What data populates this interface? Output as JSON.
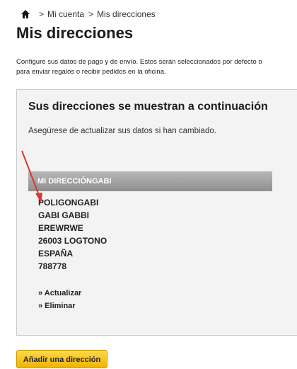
{
  "breadcrumb": {
    "separator": ">",
    "items": [
      "Mi cuenta",
      "Mis direcciones"
    ]
  },
  "page": {
    "title": "Mis direcciones",
    "intro_line1": "Configure sus datos de pago y de envío. Estos serán seleccionados por defecto o",
    "intro_line2": "para enviar regalos o recibir pedidos en la oficina."
  },
  "panel": {
    "heading": "Sus direcciones se muestran a continuación",
    "note": "Asegúrese de actualizar sus datos si han cambiado."
  },
  "address": {
    "title": "MI DIRECCIÓNGABI",
    "lines": [
      "POLIGONGABI",
      "GABI GABBI",
      "EREWRWE",
      "26003 LOGTONO",
      "ESPAÑA",
      "788778"
    ],
    "update_label": "» Actualizar",
    "delete_label": "» Eliminar"
  },
  "actions": {
    "add_label": "Añadir una dirección"
  },
  "colors": {
    "accent": "#f5c000",
    "annotation": "#e23232"
  },
  "icons": {
    "home": "home-icon"
  }
}
